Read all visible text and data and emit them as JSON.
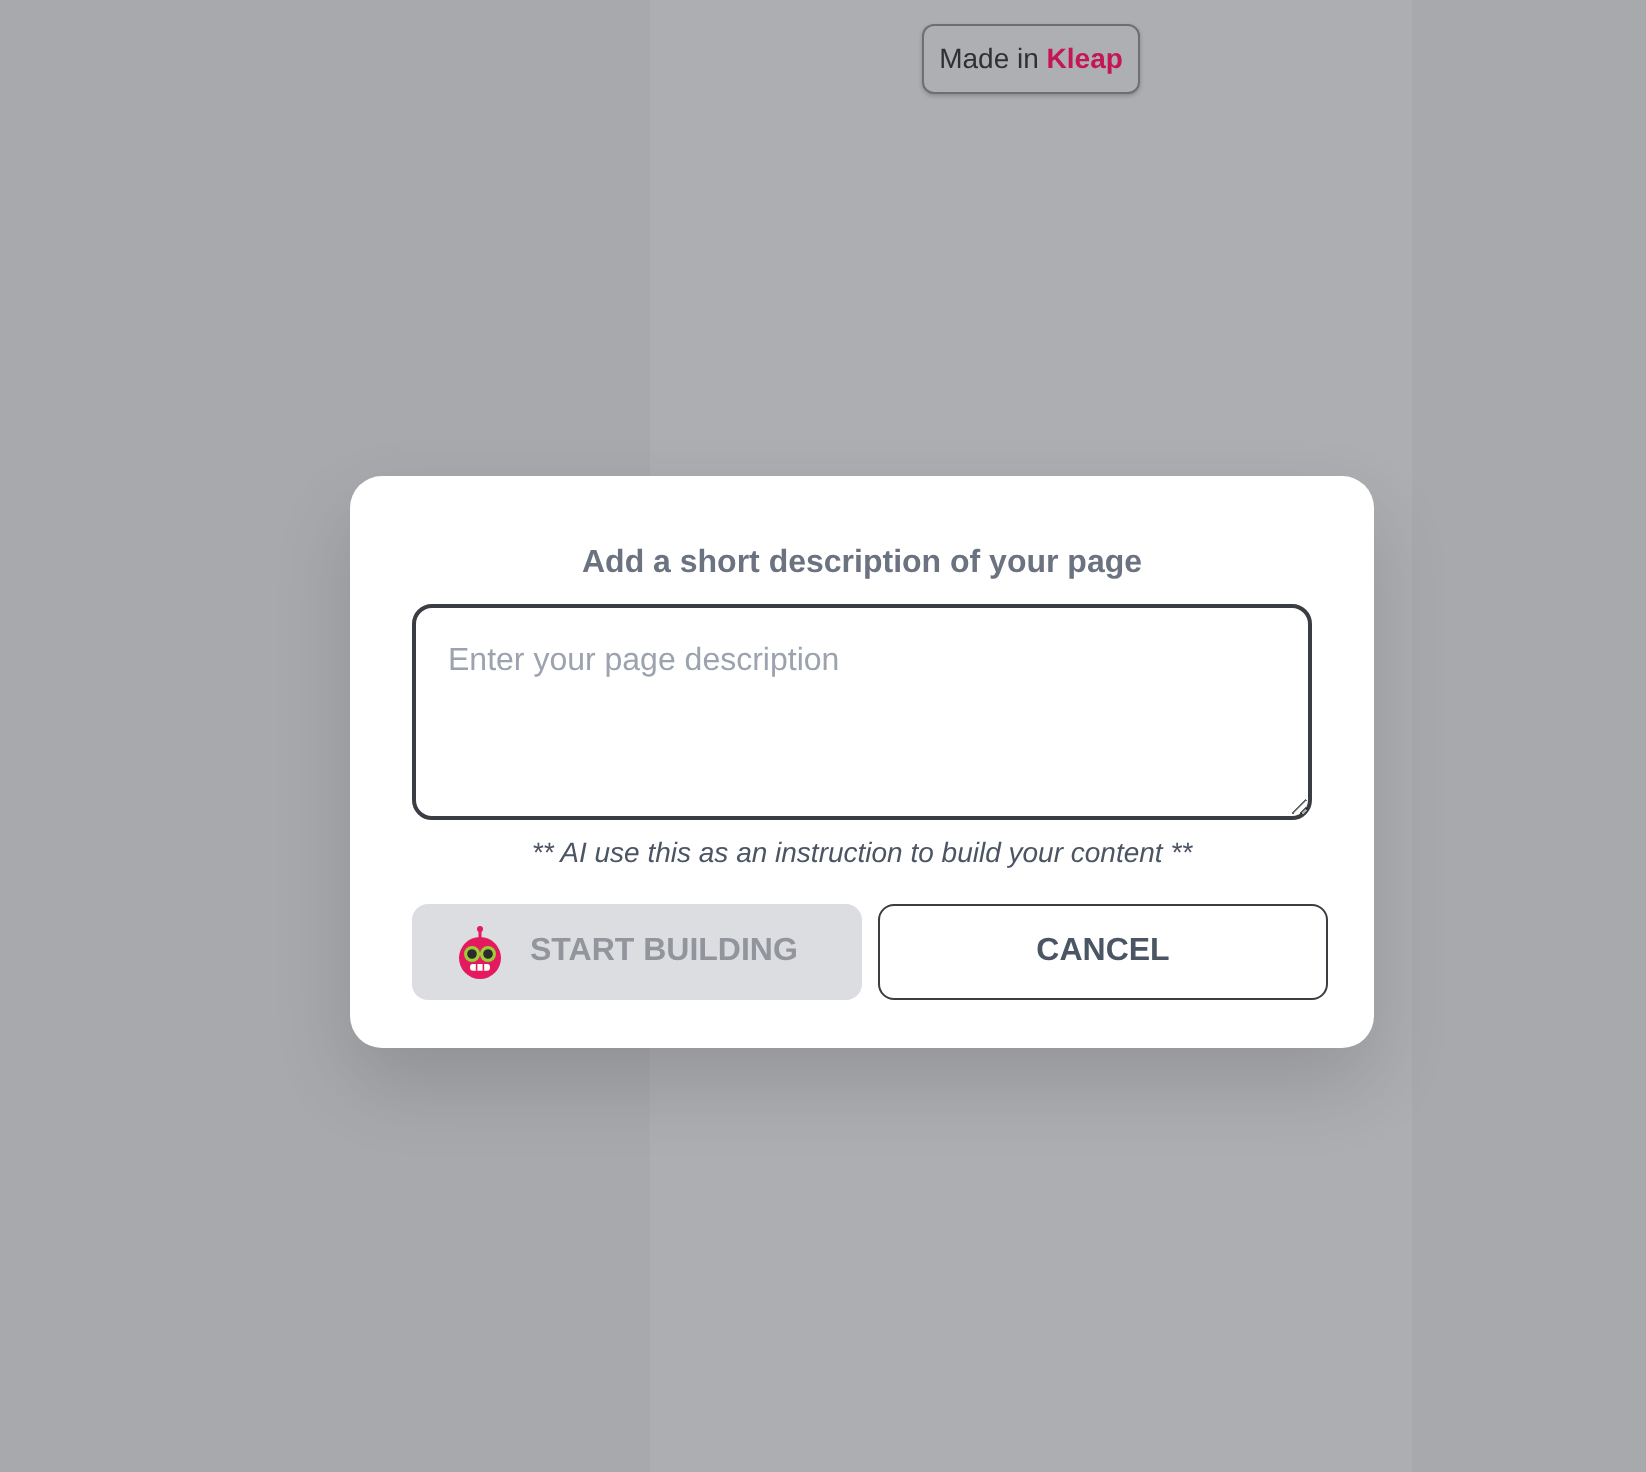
{
  "badge": {
    "text": "Made in **Kleap**"
  },
  "dialog": {
    "title": "Add a short description of your page",
    "description_field": {
      "placeholder": "Enter your page description"
    },
    "hint": "** AI use this as an instruction to build your content **",
    "buttons": [
      {
        "kind": "primary",
        "label": "START BUILDING",
        "disabled": true
      },
      {
        "kind": "secondary",
        "label": "CANCEL",
        "disabled": false
      }
    ]
  }
}
